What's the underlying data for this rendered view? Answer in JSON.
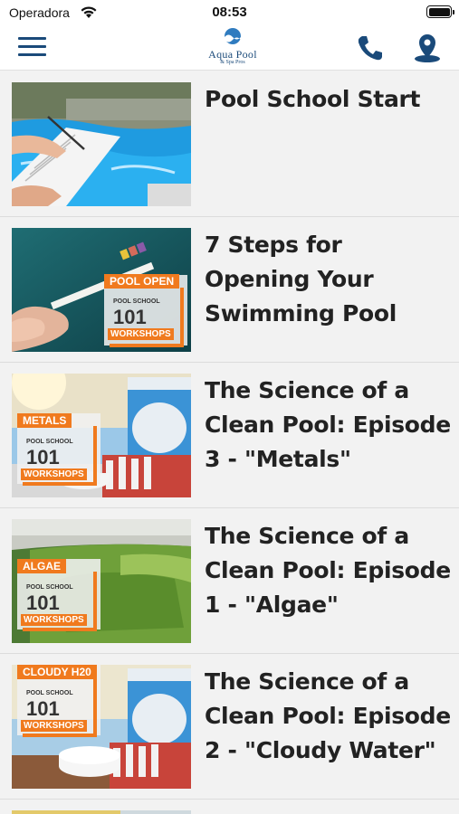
{
  "status": {
    "carrier": "Operadora",
    "time": "08:53",
    "battery_level": 1.0
  },
  "navbar": {
    "logo": {
      "name": "Aqua Pool",
      "sub": "& Spa Pros"
    },
    "icons": {
      "menu": "hamburger-menu-icon",
      "phone": "phone-icon",
      "map": "map-pin-icon"
    },
    "accent": "#1a4a7a"
  },
  "badge_colors": {
    "orange": "#f07a1e"
  },
  "items": [
    {
      "title": "Pool School Start",
      "badge": null
    },
    {
      "title": "7 Steps for Opening Your Swimming Pool",
      "badge": {
        "head": "POOL OPEN",
        "small": "POOL SCHOOL",
        "num": "101",
        "work": "WORKSHOPS"
      }
    },
    {
      "title": "The Science of a Clean Pool: Episode 3 - \"Metals\"",
      "badge": {
        "head": "METALS",
        "small": "POOL SCHOOL",
        "num": "101",
        "work": "WORKSHOPS"
      }
    },
    {
      "title": "The Science of a Clean Pool: Episode 1 - \"Algae\"",
      "badge": {
        "head": "ALGAE",
        "small": "POOL SCHOOL",
        "num": "101",
        "work": "WORKSHOPS"
      }
    },
    {
      "title": "The Science of a Clean Pool: Episode 2 - \"Cloudy Water\"",
      "badge": {
        "head": "CLOUDY H20",
        "small": "POOL SCHOOL",
        "num": "101",
        "work": "WORKSHOPS"
      }
    }
  ]
}
